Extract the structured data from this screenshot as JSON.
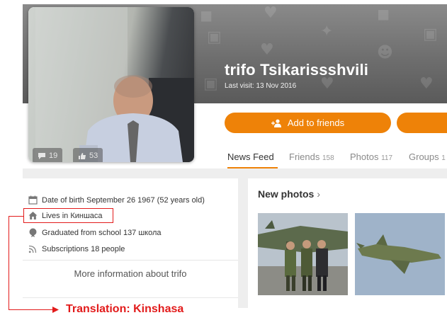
{
  "colors": {
    "accent": "#ee8208",
    "annotation": "#e21b1b"
  },
  "profile": {
    "name": "trifo Tsikarissshvili",
    "last_visit": "Last visit: 13 Nov 2016"
  },
  "avatar": {
    "comments_count": "19",
    "likes_count": "53",
    "comments_icon": "comment-icon",
    "likes_icon": "thumbs-up-icon"
  },
  "actions": {
    "add_friends_label": "Add to friends",
    "add_friends_icon": "add-user-icon"
  },
  "tabs": [
    {
      "label": "News Feed",
      "count": "",
      "active": true
    },
    {
      "label": "Friends",
      "count": "158",
      "active": false
    },
    {
      "label": "Photos",
      "count": "117",
      "active": false
    },
    {
      "label": "Groups",
      "count": "1",
      "active": false
    }
  ],
  "info": {
    "birth": "Date of birth September 26 1967 (52 years old)",
    "lives": "Lives in Киншаса",
    "school": "Graduated from school 137 школа",
    "subscriptions": "Subscriptions 18 people",
    "more": "More information about trifo",
    "icons": [
      "calendar-icon",
      "home-icon",
      "education-icon",
      "rss-icon"
    ]
  },
  "photos": {
    "heading": "New photos",
    "chevron": "›"
  },
  "annotation": {
    "translation": "Translation: Kinshasa"
  }
}
